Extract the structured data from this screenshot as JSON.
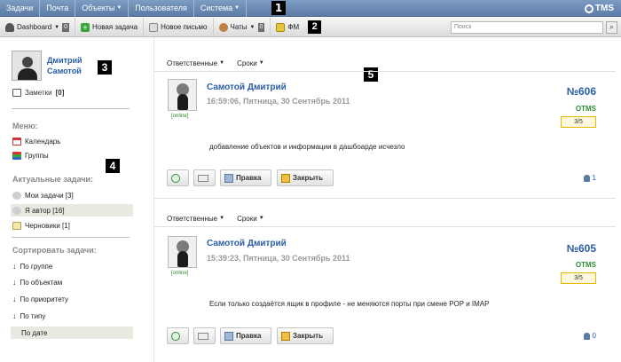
{
  "topnav": {
    "items": [
      {
        "label": "Задачи",
        "caret": false
      },
      {
        "label": "Почта",
        "caret": false
      },
      {
        "label": "Объекты",
        "caret": true
      },
      {
        "label": "Пользователя",
        "caret": false
      },
      {
        "label": "Система",
        "caret": true
      }
    ],
    "marker": "1",
    "logo": "TMS"
  },
  "toolbar": {
    "dashboard_label": "Dashboard",
    "dashboard_count": "0",
    "new_task_label": "Новая задача",
    "new_mail_label": "Новое письмо",
    "chats_label": "Чаты",
    "chats_count": "0",
    "fm_label": "ФМ",
    "marker": "2",
    "search_placeholder": "Поиск"
  },
  "sidebar": {
    "user_first": "Дмитрий",
    "user_last": "Самотой",
    "marker": "3",
    "notes_label": "Заметки",
    "notes_count": "[0]",
    "menu_title": "Меню:",
    "menu_items": [
      "Календарь",
      "Группы"
    ],
    "marker4": "4",
    "actual_title": "Актуальные задачи:",
    "actual_items": [
      "Мои задачи [3]",
      "Я автор [16]",
      "Черновики [1]"
    ],
    "sort_title": "Сортировать задачи:",
    "sort_items": [
      "По группе",
      "По объектам",
      "По приоритету",
      "По типу",
      "По дате"
    ]
  },
  "main": {
    "marker": "5",
    "filter_responsible": "Ответственные",
    "filter_deadline": "Сроки",
    "tasks": [
      {
        "author": "Самотой Дмитрий",
        "online": "[online]",
        "date": "16:59:06, Пятница, 30 Сентябрь 2011",
        "number": "№606",
        "project": "OTMS",
        "progress": "3/5",
        "text": "добавление объектов и информации в дашбоарде исчезло",
        "edit_label": "Правка",
        "close_label": "Закрыть",
        "users_count": "1"
      },
      {
        "author": "Самотой Дмитрий",
        "online": "[online]",
        "date": "15:39:23, Пятница, 30 Сентябрь 2011",
        "number": "№605",
        "project": "OTMS",
        "progress": "3/5",
        "text": "Если только создаётся ящик в профиле - не меняются порты при смене POP и IMAP",
        "edit_label": "Правка",
        "close_label": "Закрыть",
        "users_count": "0"
      }
    ]
  }
}
